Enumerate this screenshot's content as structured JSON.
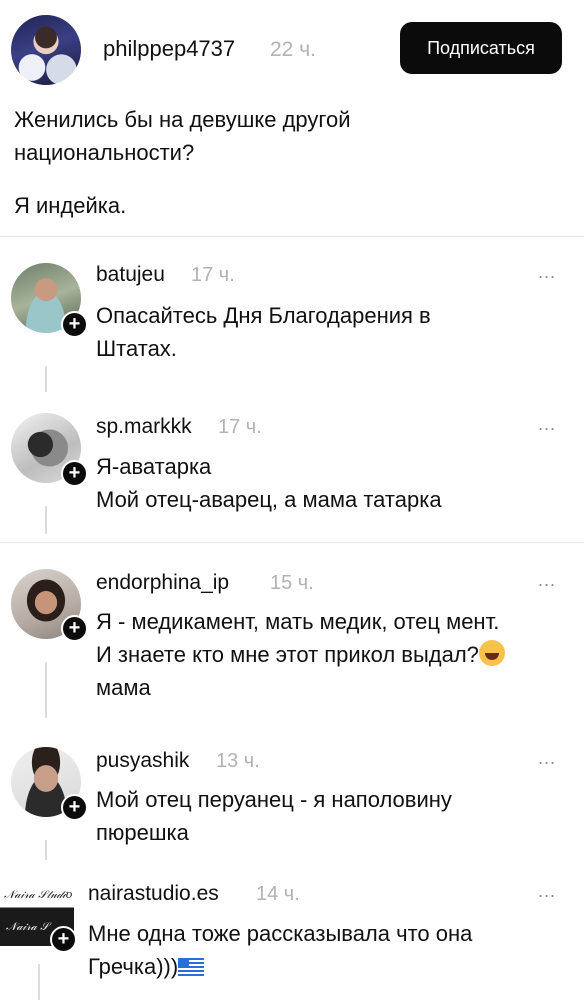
{
  "post": {
    "username": "philppep4737",
    "time": "22 ч.",
    "subscribe_label": "Подписаться",
    "text_line1": "Женились бы на девушке другой",
    "text_line2": "национальности?",
    "text_line3": "Я индейка."
  },
  "comments": [
    {
      "username": "batujeu",
      "time": "17 ч.",
      "more": "...",
      "text": "Опасайтесь Дня Благодарения в Штатах."
    },
    {
      "username": "sp.markkk",
      "time": "17 ч.",
      "more": "...",
      "text_line1": "Я-аватарка",
      "text_line2": "Мой отец-аварец, а мама татарка"
    },
    {
      "username": "endorphina_ip",
      "time": "15 ч.",
      "more": "...",
      "text_line1": "Я - медикамент, мать медик, отец мент.",
      "text_line2": "И знаете кто мне этот прикол выдал?",
      "text_line3": "мама"
    },
    {
      "username": "pusyashik",
      "time": "13 ч.",
      "more": "...",
      "text": "Мой отец перуанец - я наполовину пюрешка"
    },
    {
      "username": "nairastudio.es",
      "time": "14 ч.",
      "more": "...",
      "text_line1": "Мне одна тоже рассказывала что она",
      "text_line2": "Гречка)))"
    }
  ],
  "icons": {
    "plus": "+",
    "laugh_emoji": "grinning-squinting-face",
    "flag": "greece-flag"
  }
}
